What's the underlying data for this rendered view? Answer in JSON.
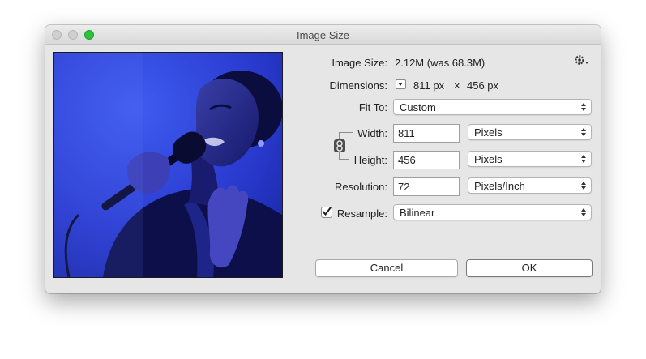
{
  "window": {
    "title": "Image Size"
  },
  "info": {
    "image_size_label": "Image Size:",
    "image_size_value": "2.12M (was 68.3M)",
    "dimensions_label": "Dimensions:",
    "dimensions_width": "811 px",
    "dimensions_times": "×",
    "dimensions_height": "456 px"
  },
  "fit_to": {
    "label": "Fit To:",
    "value": "Custom"
  },
  "width": {
    "label": "Width:",
    "value": "811",
    "unit": "Pixels"
  },
  "height": {
    "label": "Height:",
    "value": "456",
    "unit": "Pixels"
  },
  "resolution": {
    "label": "Resolution:",
    "value": "72",
    "unit": "Pixels/Inch"
  },
  "resample": {
    "label": "Resample:",
    "checked": true,
    "value": "Bilinear"
  },
  "buttons": {
    "cancel": "Cancel",
    "ok": "OK"
  },
  "icons": {
    "gear": "gear-icon",
    "link": "chain-link-icon",
    "check": "checkmark-icon"
  },
  "colors": {
    "preview_tint": "#2f3fd6",
    "zoom_button": "#2bc440"
  }
}
